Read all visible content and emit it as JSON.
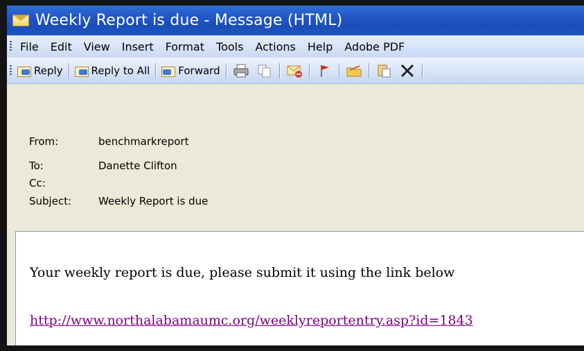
{
  "window": {
    "title": "Weekly Report is due - Message (HTML)"
  },
  "menu": {
    "items": [
      "File",
      "Edit",
      "View",
      "Insert",
      "Format",
      "Tools",
      "Actions",
      "Help",
      "Adobe PDF"
    ]
  },
  "toolbar": {
    "reply_label": "Reply",
    "reply_all_label": "Reply to All",
    "forward_label": "Forward"
  },
  "message": {
    "from_label": "From:",
    "from_value": "benchmarkreport",
    "to_label": "To:",
    "to_value": "Danette Clifton",
    "cc_label": "Cc:",
    "cc_value": "",
    "subject_label": "Subject:",
    "subject_value": "Weekly Report is due",
    "body_text": "Your weekly report is due, please submit it using the link below",
    "body_link": "http://www.northalabamaumc.org/weeklyreportentry.asp?id=1843"
  }
}
